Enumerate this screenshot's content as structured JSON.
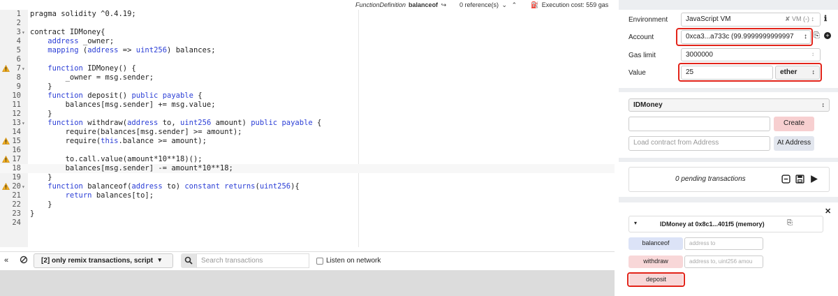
{
  "editor": {
    "header": {
      "definition_type": "FunctionDefinition",
      "definition_name": "balanceof",
      "references": "0 reference(s)",
      "execution_cost": "Execution cost: 559 gas"
    },
    "lines": [
      {
        "n": "1",
        "text": "pragma solidity ^0.4.19;"
      },
      {
        "n": "2",
        "text": ""
      },
      {
        "n": "3",
        "text": "contract IDMoney{"
      },
      {
        "n": "4",
        "text": "    address _owner;"
      },
      {
        "n": "5",
        "text": "    mapping (address => uint256) balances;"
      },
      {
        "n": "6",
        "text": ""
      },
      {
        "n": "7",
        "text": "    function IDMoney() {"
      },
      {
        "n": "8",
        "text": "        _owner = msg.sender;"
      },
      {
        "n": "9",
        "text": "    }"
      },
      {
        "n": "10",
        "text": "    function deposit() public payable {"
      },
      {
        "n": "11",
        "text": "        balances[msg.sender] += msg.value;"
      },
      {
        "n": "12",
        "text": "    }"
      },
      {
        "n": "13",
        "text": "    function withdraw(address to, uint256 amount) public payable {"
      },
      {
        "n": "14",
        "text": "        require(balances[msg.sender] >= amount);"
      },
      {
        "n": "15",
        "text": "        require(this.balance >= amount);"
      },
      {
        "n": "16",
        "text": ""
      },
      {
        "n": "17",
        "text": "        to.call.value(amount*10**18)();"
      },
      {
        "n": "18",
        "text": "        balances[msg.sender] -= amount*10**18;"
      },
      {
        "n": "19",
        "text": "    }"
      },
      {
        "n": "20",
        "text": "    function balanceof(address to) constant returns(uint256){"
      },
      {
        "n": "21",
        "text": "        return balances[to];"
      },
      {
        "n": "22",
        "text": "    }"
      },
      {
        "n": "23",
        "text": "}"
      },
      {
        "n": "24",
        "text": ""
      }
    ],
    "warnings": [
      "7",
      "15",
      "17",
      "20"
    ],
    "folds": [
      "3",
      "7",
      "13",
      "20"
    ]
  },
  "terminal": {
    "filter_label": "[2] only remix transactions, script",
    "search_placeholder": "Search transactions",
    "listen_label": "Listen on network"
  },
  "run_panel": {
    "environment_label": "Environment",
    "environment_value": "JavaScript VM",
    "vm_badge": "VM (-)",
    "account_label": "Account",
    "account_value": "0xca3...a733c (99.9999999999997",
    "gas_limit_label": "Gas limit",
    "gas_limit_value": "3000000",
    "value_label": "Value",
    "value_value": "25",
    "value_unit": "ether",
    "contract_select": "IDMoney",
    "create_button": "Create",
    "at_address_placeholder": "Load contract from Address",
    "at_address_button": "At Address",
    "pending_transactions": "0 pending transactions",
    "instance_title": "IDMoney at 0x8c1...401f5 (memory)",
    "functions": [
      {
        "name": "balanceof",
        "placeholder": "address to"
      },
      {
        "name": "withdraw",
        "placeholder": "address to, uint256 amou"
      },
      {
        "name": "deposit",
        "placeholder": ""
      }
    ]
  },
  "colors": {
    "keyword": "#2b3ed6",
    "highlight": "#e2241a",
    "constant_button": "#dce3f7",
    "payable_button": "#f8d7d8",
    "create_button": "#f7cfd0"
  }
}
